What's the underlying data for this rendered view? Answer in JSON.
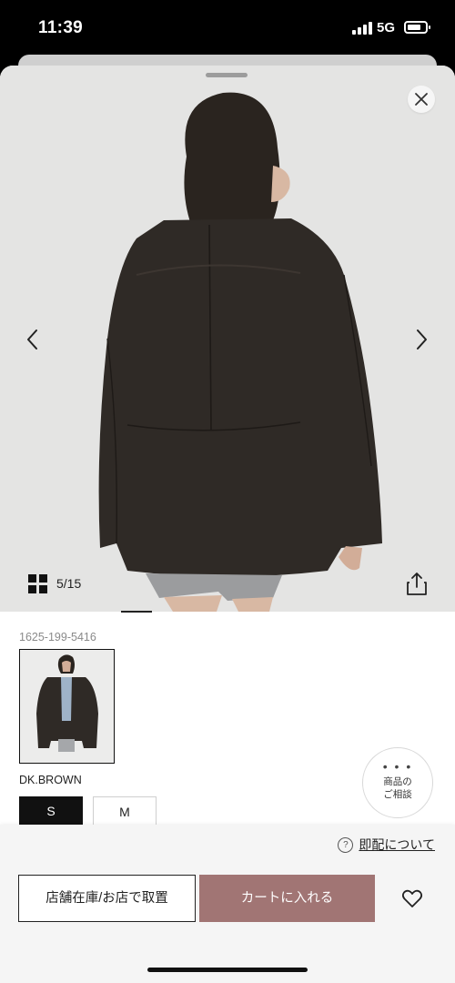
{
  "status_bar": {
    "time": "11:39",
    "network": "5G"
  },
  "gallery": {
    "counter": "5/15"
  },
  "product": {
    "sku": "1625-199-5416",
    "color_name": "DK.BROWN",
    "sizes": [
      "S",
      "M"
    ],
    "selected_size": "S"
  },
  "consult": {
    "label": "商品の\nご相談"
  },
  "bottom_bar": {
    "delivery_link": "即配について",
    "store_button": "店舗在庫/お店で取置",
    "cart_button": "カートに入れる"
  },
  "colors": {
    "accent": "#a17574",
    "background_gallery": "#e4e4e3"
  },
  "icons": [
    "signal-icon",
    "battery-icon",
    "close-icon",
    "chevron-left-icon",
    "chevron-right-icon",
    "grid-icon",
    "share-icon",
    "help-icon",
    "heart-icon"
  ]
}
